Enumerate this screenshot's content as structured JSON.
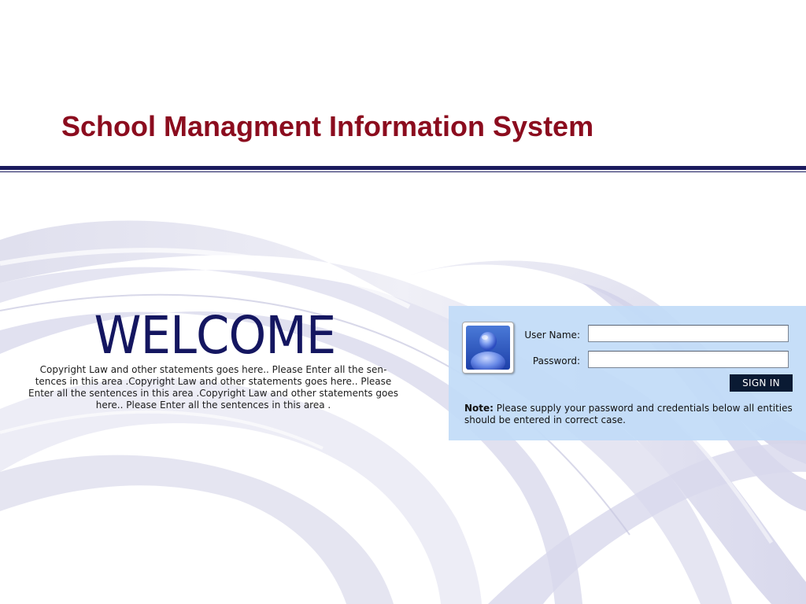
{
  "header": {
    "title": "School Managment Information System",
    "title_color": "#8b0c1e",
    "rule_color": "#1a1a5e"
  },
  "welcome": {
    "heading": "WELCOME",
    "heading_color": "#141660",
    "text": "Copyright Law and other statements goes here.. Please Enter all the sen-tences in this area .Copyright Law and other statements goes here.. Please Enter all the sentences in this area .Copyright Law and other statements goes here.. Please Enter all the sentences in this area ."
  },
  "login": {
    "panel_color": "#c2dcf7",
    "avatar_icon": "user-avatar-icon",
    "username_label": "User Name:",
    "username_value": "",
    "password_label": "Password:",
    "password_value": "",
    "signin_label": "SIGN IN",
    "signin_color": "#0a1a33",
    "note_label": "Note:",
    "note_text": " Please supply your password and credentials below all entities should be entered in correct case."
  }
}
